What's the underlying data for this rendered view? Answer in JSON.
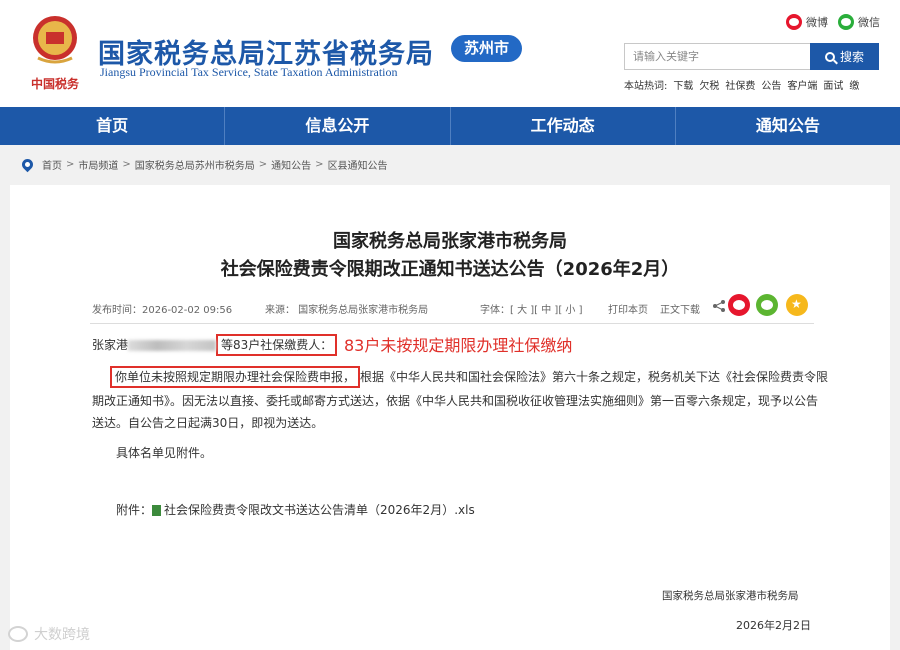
{
  "header": {
    "title": "国家税务总局江苏省税务局",
    "city_badge": "苏州市",
    "subtitle": "Jiangsu Provincial Tax Service, State Taxation Administration",
    "emblem_text": "中国税务",
    "social": [
      {
        "label": "微博",
        "icon": "weibo-icon"
      },
      {
        "label": "微信",
        "icon": "wechat-icon"
      }
    ],
    "search": {
      "placeholder": "请输入关键字",
      "button_label": "搜索"
    },
    "hot_words_label": "本站热词:",
    "hot_words": [
      "下载",
      "欠税",
      "社保费",
      "公告",
      "客户端",
      "面试",
      "缴"
    ]
  },
  "nav": {
    "items": [
      "首页",
      "信息公开",
      "工作动态",
      "通知公告"
    ],
    "color": "#1d58a8"
  },
  "breadcrumb": [
    "首页",
    "市局频道",
    "国家税务总局苏州市税务局",
    "通知公告",
    "区县通知公告"
  ],
  "article": {
    "title_line1": "国家税务总局张家港市税务局",
    "title_line2": "社会保险费责令限期改正通知书送达公告（2026年2月）",
    "meta": {
      "publish_time": "发布时间：2026-02-02 09:56",
      "source": "来源：   国家税务总局张家港市税务局",
      "font_size_label": "字体：[ 大 ][ 中 ][ 小 ]",
      "print": "打印本页",
      "download": "正文下载"
    },
    "para1_prefix": "张家港",
    "para1_boxed": "等83户社保缴费人：",
    "annotation": "83户未按规定期限办理社保缴纳",
    "para2_boxed": "你单位未按照规定期限办理社会保险费申报，",
    "para2_rest": "根据《中华人民共和国社会保险法》第六十条之规定，税务机关下达《社会保险费责令限",
    "para2_line2": "期改正通知书》。因无法以直接、委托或邮寄方式送达，依据《中华人民共和国税收征收管理法实施细则》第一百零六条规定，现予以公告",
    "para2_line3": "送达。自公告之日起满30日，即视为送达。",
    "para3": "具体名单见附件。",
    "attachment_label": "附件：",
    "attachment_file": "社会保险费责令限改文书送达公告清单（2026年2月）.xls",
    "sign_org": "国家税务总局张家港市税务局",
    "sign_date": "2026年2月2日"
  },
  "watermark": "大数跨境",
  "colors": {
    "accent": "#1d58a8",
    "annotation_red": "#e0302a"
  }
}
